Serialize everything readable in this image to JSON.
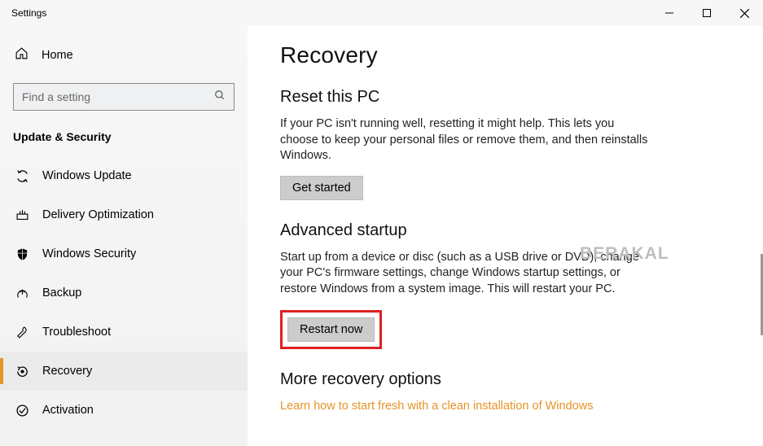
{
  "window": {
    "title": "Settings"
  },
  "sidebar": {
    "home": "Home",
    "search_placeholder": "Find a setting",
    "section": "Update & Security",
    "items": [
      {
        "label": "Windows Update"
      },
      {
        "label": "Delivery Optimization"
      },
      {
        "label": "Windows Security"
      },
      {
        "label": "Backup"
      },
      {
        "label": "Troubleshoot"
      },
      {
        "label": "Recovery"
      },
      {
        "label": "Activation"
      }
    ]
  },
  "main": {
    "title": "Recovery",
    "reset": {
      "heading": "Reset this PC",
      "body": "If your PC isn't running well, resetting it might help. This lets you choose to keep your personal files or remove them, and then reinstalls Windows.",
      "button": "Get started"
    },
    "advanced": {
      "heading": "Advanced startup",
      "body": "Start up from a device or disc (such as a USB drive or DVD), change your PC's firmware settings, change Windows startup settings, or restore Windows from a system image. This will restart your PC.",
      "button": "Restart now"
    },
    "more": {
      "heading": "More recovery options",
      "link": "Learn how to start fresh with a clean installation of Windows"
    }
  },
  "watermark": "BERAKAL"
}
